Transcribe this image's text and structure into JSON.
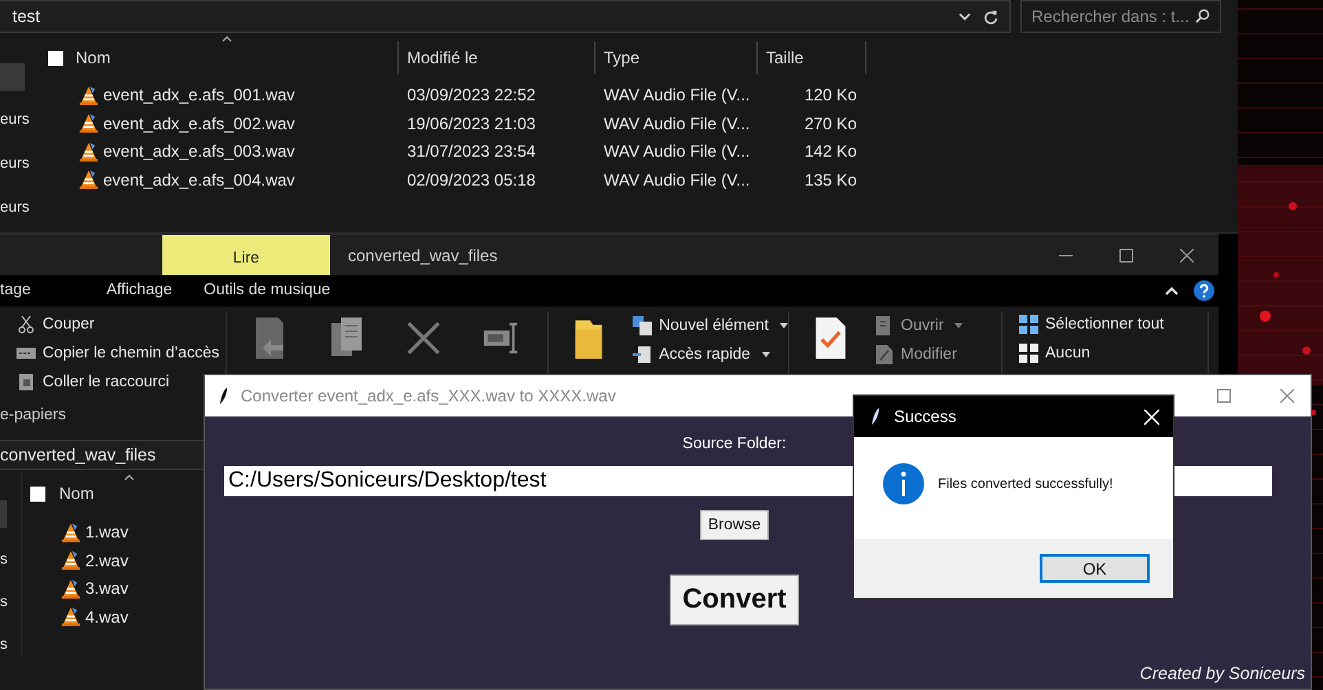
{
  "explorer_back": {
    "address": "test",
    "search": {
      "placeholder": "Rechercher dans : t..."
    },
    "nav_items": [
      "eurs",
      "eurs",
      "eurs"
    ],
    "select_all_checked": false,
    "columns": [
      "Nom",
      "Modifié le",
      "Type",
      "Taille"
    ],
    "rows": [
      {
        "name": "event_adx_e.afs_001.wav",
        "modified": "03/09/2023 22:52",
        "type": "WAV Audio File (V...",
        "size": "120 Ko"
      },
      {
        "name": "event_adx_e.afs_002.wav",
        "modified": "19/06/2023 21:03",
        "type": "WAV Audio File (V...",
        "size": "270 Ko"
      },
      {
        "name": "event_adx_e.afs_003.wav",
        "modified": "31/07/2023 23:54",
        "type": "WAV Audio File (V...",
        "size": "142 Ko"
      },
      {
        "name": "event_adx_e.afs_004.wav",
        "modified": "02/09/2023 05:18",
        "type": "WAV Audio File (V...",
        "size": "135 Ko"
      }
    ]
  },
  "explorer_front": {
    "context_tab": "Lire",
    "title": "converted_wav_files",
    "ribbon_tabs": [
      "tage",
      "Affichage",
      "Outils de musique"
    ],
    "clipboard": [
      "Couper",
      "Copier le chemin d’accès",
      "Coller le raccourci"
    ],
    "clipboard_group": "e-papiers",
    "new_items": [
      "Nouvel élément",
      "Accès rapide"
    ],
    "open_items": [
      {
        "label": "Ouvrir",
        "dropdown": true
      },
      {
        "label": "Modifier",
        "dropdown": false
      }
    ],
    "select_items": [
      "Sélectionner tout",
      "Aucun"
    ],
    "address": "converted_wav_files",
    "nav_items": [
      "s",
      "s",
      "s"
    ],
    "select_all_checked": false,
    "columns": [
      "Nom"
    ],
    "rows": [
      "1.wav",
      "2.wav",
      "3.wav",
      "4.wav"
    ]
  },
  "converter": {
    "title": "Converter event_adx_e.afs_XXX.wav to XXXX.wav",
    "source_label": "Source Folder:",
    "source_value": "C:/Users/Soniceurs/Desktop/test",
    "browse": "Browse",
    "convert": "Convert",
    "credit": "Created by Soniceurs"
  },
  "dialog": {
    "title": "Success",
    "message": "Files converted successfully!",
    "ok": "OK"
  }
}
